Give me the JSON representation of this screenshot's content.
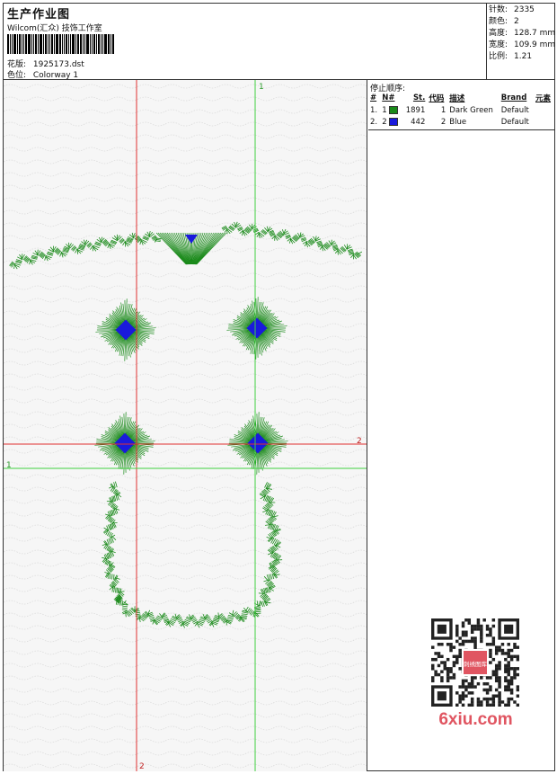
{
  "header": {
    "title": "生产作业图",
    "company": "Wilcom(汇众) 技饰工作室",
    "design_label": "花版:",
    "design_value": "1925173.dst",
    "colorway_label": "色位:",
    "colorway_value": "Colorway 1"
  },
  "stats": [
    {
      "label": "针数:",
      "value": "2335"
    },
    {
      "label": "颜色:",
      "value": "2"
    },
    {
      "label": "高度:",
      "value": "128.7 mm"
    },
    {
      "label": "宽度:",
      "value": "109.9 mm"
    },
    {
      "label": "比例:",
      "value": "1.21"
    }
  ],
  "stop_sequence": {
    "title": "停止顺序:",
    "columns": [
      "#",
      "N#",
      "St.",
      "代码",
      "描述",
      "Brand",
      "元素"
    ],
    "rows": [
      {
        "seq": "1.",
        "n": "1",
        "color": "#1a8a1a",
        "stitches": "1891",
        "code": "1",
        "description": "Dark Green",
        "brand": "Default",
        "element": ""
      },
      {
        "seq": "2.",
        "n": "2",
        "color": "#1a1adc",
        "stitches": "442",
        "code": "2",
        "description": "Blue",
        "brand": "Default",
        "element": ""
      }
    ]
  },
  "guides": {
    "green_label": "1",
    "red_label": "2"
  },
  "watermark": {
    "site": "6xiu.com",
    "stamp_text": "刺绣图库"
  },
  "colors": {
    "thread_green": "#1a8a1a",
    "thread_blue": "#1a1adc",
    "guide_red": "#e03030",
    "guide_green": "#40d040",
    "accent_pink": "#e05561"
  }
}
